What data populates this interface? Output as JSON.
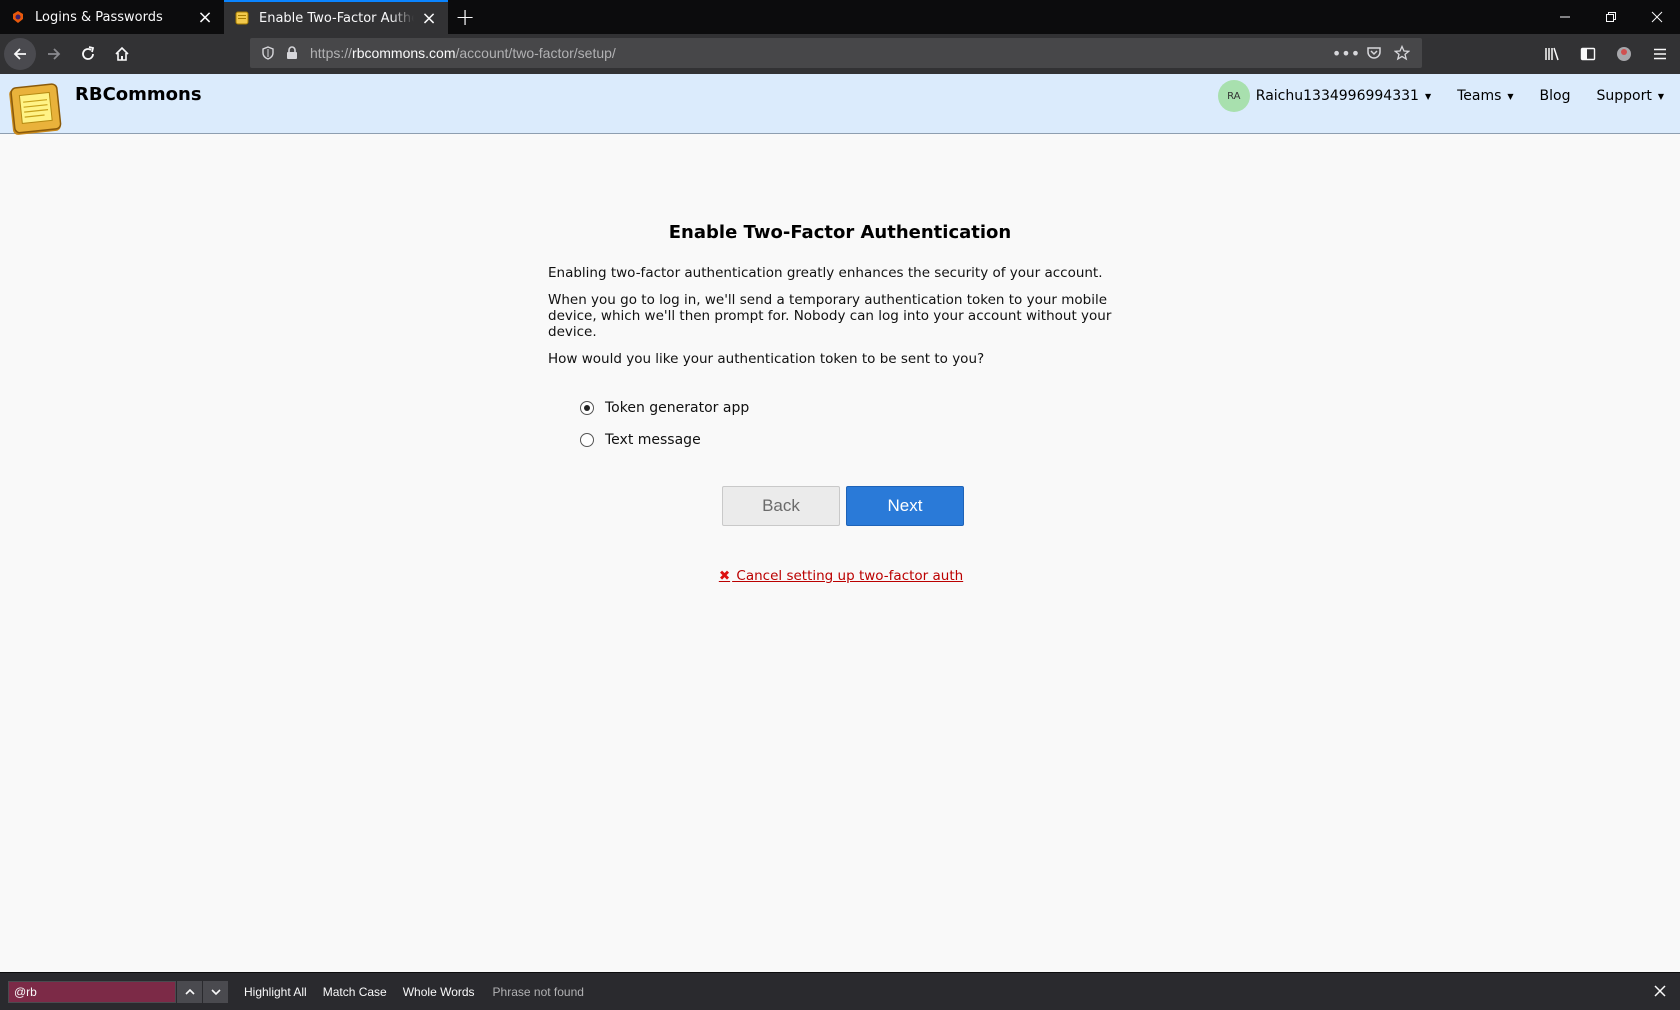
{
  "browser": {
    "tabs": [
      {
        "title": "Logins & Passwords",
        "active": false,
        "icon": "lock-fox-icon"
      },
      {
        "title": "Enable Two-Factor Authenticati",
        "active": true,
        "icon": "notepad-icon"
      }
    ],
    "url_prefix": "https://",
    "url_domain": "rbcommons.com",
    "url_path": "/account/two-factor/setup/"
  },
  "header": {
    "brand": "RBCommons",
    "avatar_initials": "RA",
    "username": "Raichu1334996994331",
    "nav": [
      "Teams",
      "Blog",
      "Support"
    ]
  },
  "main": {
    "title": "Enable Two-Factor Authentication",
    "paragraphs": [
      "Enabling two-factor authentication greatly enhances the security of your account.",
      "When you go to log in, we'll send a temporary authentication token to your mobile device, which we'll then prompt for. Nobody can log into your account without your device.",
      "How would you like your authentication token to be sent to you?"
    ],
    "options": [
      {
        "label": "Token generator app",
        "checked": true
      },
      {
        "label": "Text message",
        "checked": false
      }
    ],
    "back_label": "Back",
    "next_label": "Next",
    "cancel_label": " Cancel setting up two-factor auth"
  },
  "findbar": {
    "query": "@rb",
    "highlight_all": "Highlight All",
    "match_case": "Match Case",
    "whole_words": "Whole Words",
    "status": "Phrase not found"
  },
  "colors": {
    "header_bg": "#dbebfc",
    "next_button": "#2a7ad8",
    "cancel_link": "#bb0000",
    "tab_accent": "#0a84ff"
  }
}
